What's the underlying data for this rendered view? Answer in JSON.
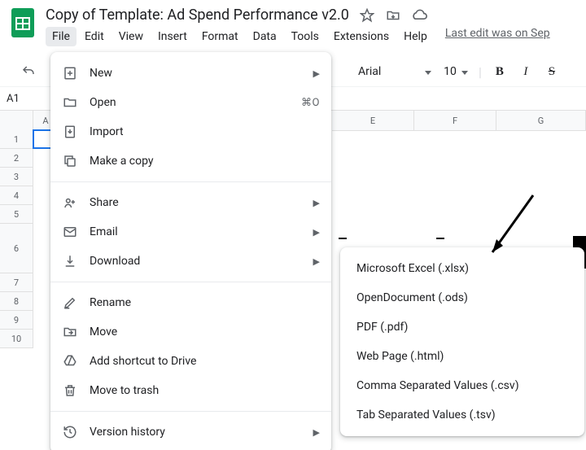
{
  "doc_title": "Copy of Template: Ad Spend Performance v2.0",
  "menu": {
    "file": "File",
    "edit": "Edit",
    "view": "View",
    "insert": "Insert",
    "format": "Format",
    "data": "Data",
    "tools": "Tools",
    "extensions": "Extensions",
    "help": "Help",
    "last_edit": "Last edit was on Sep"
  },
  "toolbar": {
    "font_name": "Arial",
    "font_size": "10",
    "bold_label": "B",
    "italic_label": "I",
    "strike_label": "S"
  },
  "name_box": "A1",
  "columns": [
    "A",
    "E",
    "F",
    "G"
  ],
  "rows": [
    "1",
    "2",
    "3",
    "4",
    "5",
    "6",
    "7",
    "8",
    "9",
    "10"
  ],
  "file_menu": {
    "new": "New",
    "open": "Open",
    "open_shortcut": "⌘O",
    "import": "Import",
    "make_copy": "Make a copy",
    "share": "Share",
    "email": "Email",
    "download": "Download",
    "rename": "Rename",
    "move": "Move",
    "add_shortcut": "Add shortcut to Drive",
    "move_to_trash": "Move to trash",
    "version_history": "Version history"
  },
  "download_submenu": {
    "xlsx": "Microsoft Excel (.xlsx)",
    "ods": "OpenDocument (.ods)",
    "pdf": "PDF (.pdf)",
    "html": "Web Page (.html)",
    "csv": "Comma Separated Values (.csv)",
    "tsv": "Tab Separated Values (.tsv)"
  }
}
